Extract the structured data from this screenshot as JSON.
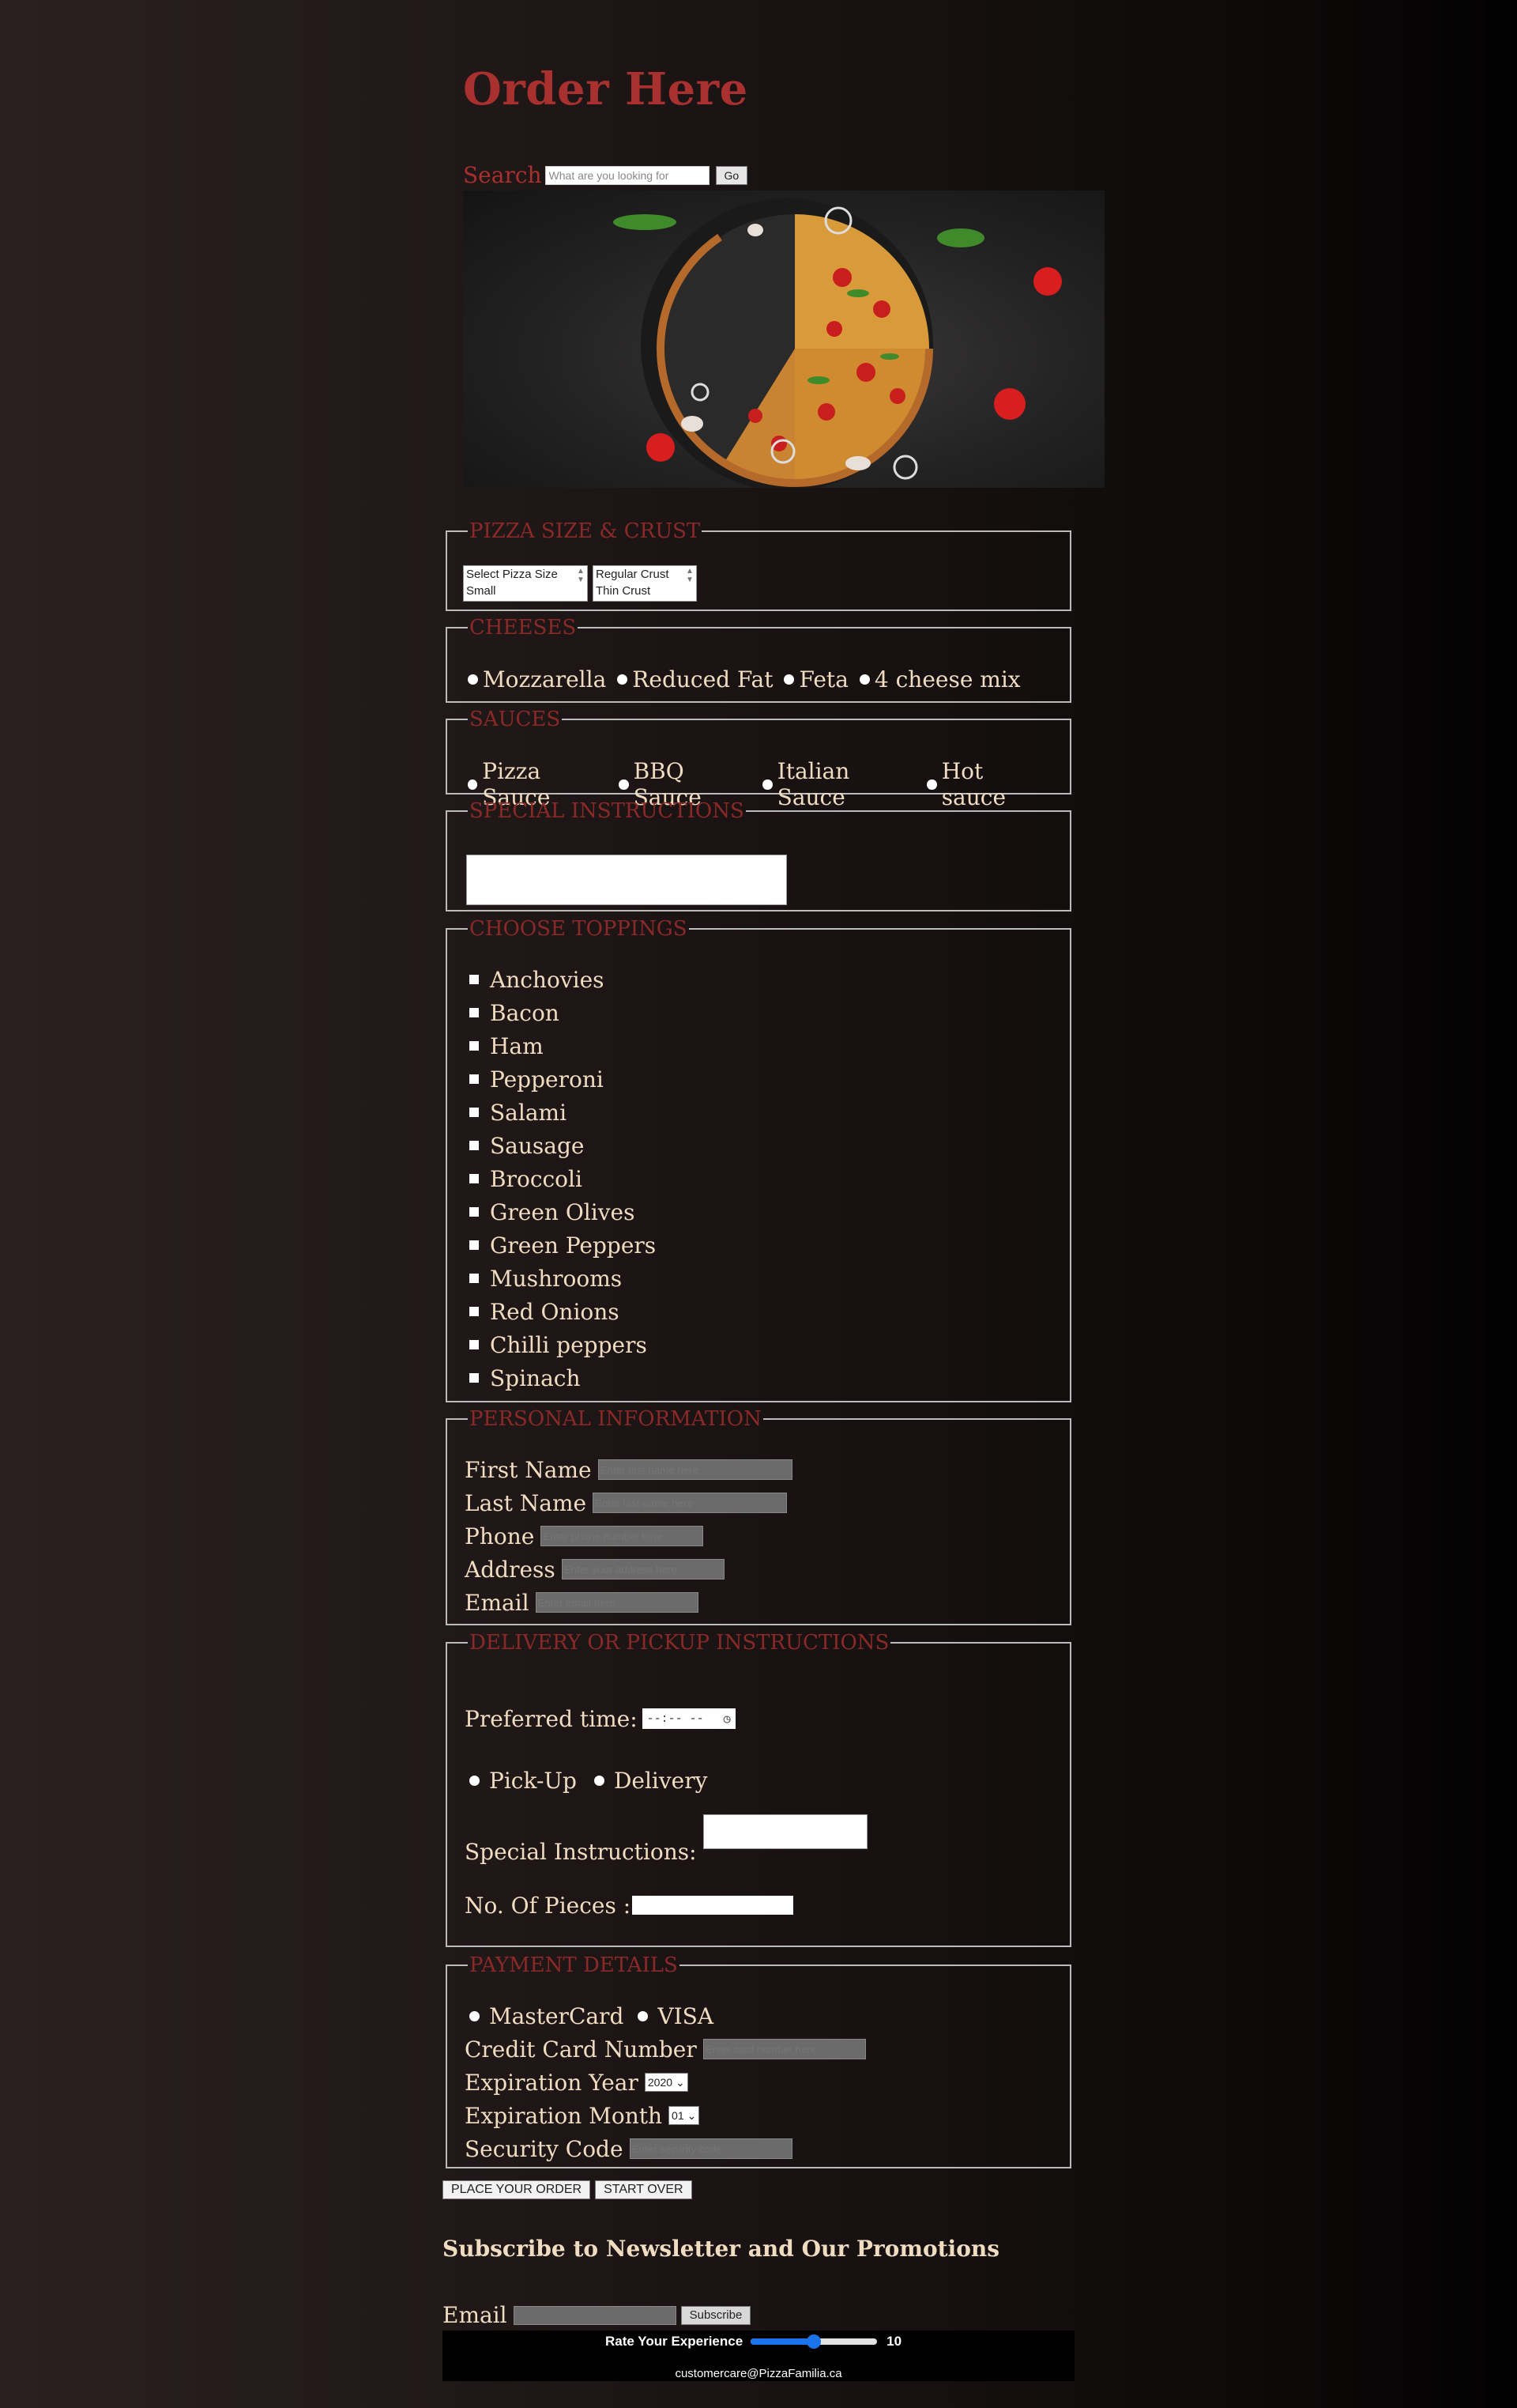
{
  "header": {
    "title": "Order Here"
  },
  "search": {
    "label": "Search",
    "placeholder": "What are you looking for",
    "button_label": "Go"
  },
  "size_crust": {
    "legend": "PIZZA SIZE & CRUST",
    "size_options": [
      "Select Pizza Size",
      "Small"
    ],
    "crust_options": [
      "Regular Crust",
      "Thin Crust"
    ]
  },
  "cheeses": {
    "legend": "CHEESES",
    "options": [
      "Mozzarella",
      "Reduced Fat",
      "Feta",
      "4 cheese mix"
    ]
  },
  "sauces": {
    "legend": "SAUCES",
    "options": [
      "Pizza Sauce",
      "BBQ Sauce",
      "Italian Sauce",
      "Hot sauce"
    ]
  },
  "special": {
    "legend": "SPECIAL INSTRUCTIONS"
  },
  "toppings": {
    "legend": "CHOOSE TOPPINGS",
    "items": [
      "Anchovies",
      "Bacon",
      "Ham",
      "Pepperoni",
      "Salami",
      "Sausage",
      "Broccoli",
      "Green Olives",
      "Green Peppers",
      "Mushrooms",
      "Red Onions",
      "Chilli peppers",
      "Spinach"
    ]
  },
  "personal": {
    "legend": "PERSONAL INFORMATION",
    "fields": [
      {
        "label": "First Name",
        "placeholder": "Enter first name here"
      },
      {
        "label": "Last Name",
        "placeholder": "Enter last name here"
      },
      {
        "label": "Phone",
        "placeholder": "Enter phone number here"
      },
      {
        "label": "Address",
        "placeholder": "Enter your address here"
      },
      {
        "label": "Email",
        "placeholder": "Enter email here"
      }
    ]
  },
  "delivery": {
    "legend": "DELIVERY OR PICKUP INSTRUCTIONS",
    "time_label": "Preferred time:",
    "time_value": "--:-- --",
    "options": [
      "Pick-Up",
      "Delivery"
    ],
    "special_label": "Special Instructions:",
    "pieces_label": "No. Of Pieces :"
  },
  "payment": {
    "legend": "PAYMENT DETAILS",
    "cards": [
      "MasterCard",
      "VISA"
    ],
    "cc_label": "Credit Card Number",
    "cc_placeholder": "Enter card number here",
    "year_label": "Expiration Year",
    "year_value": "2020",
    "month_label": "Expiration Month",
    "month_value": "01",
    "code_label": "Security Code",
    "code_placeholder": "Enter security code"
  },
  "actions": {
    "place_order": "PLACE YOUR ORDER",
    "start_over": "START OVER"
  },
  "newsletter": {
    "heading": "Subscribe to Newsletter and Our Promotions",
    "email_label": "Email",
    "subscribe_label": "Subscribe"
  },
  "rating": {
    "label": "Rate Your Experience",
    "value": "10",
    "fill_fraction": 0.5
  },
  "footer": {
    "contact": "customercare@PizzaFamilia.ca"
  },
  "colors": {
    "accent": "#a8302e",
    "text": "#f0dcc0",
    "panel": "#120d0d"
  }
}
